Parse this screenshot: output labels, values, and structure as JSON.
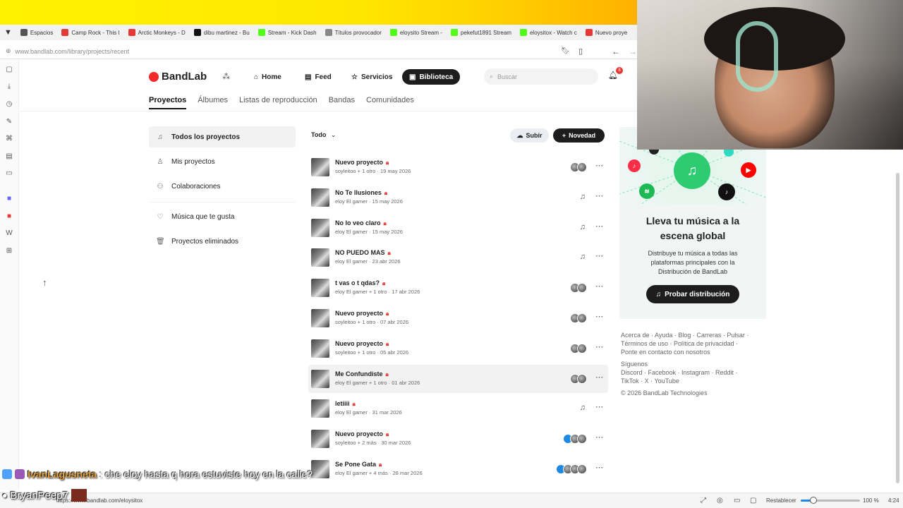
{
  "browser": {
    "tabs": [
      {
        "label": "Espacios",
        "color": "#555"
      },
      {
        "label": "Camp Rock - This I",
        "color": "#e53935"
      },
      {
        "label": "Arctic Monkeys - D",
        "color": "#e53935"
      },
      {
        "label": "dibu martinez - Bu",
        "color": "#111"
      },
      {
        "label": "Stream - Kick Dash",
        "color": "#53fc18"
      },
      {
        "label": "Títulos provocador",
        "color": "#888"
      },
      {
        "label": "eloysito Stream -",
        "color": "#53fc18"
      },
      {
        "label": "pekefut1891 Stream",
        "color": "#53fc18"
      },
      {
        "label": "eloysitox - Watch c",
        "color": "#53fc18"
      },
      {
        "label": "Nuevo proye",
        "color": "#e53935"
      }
    ],
    "url": "www.bandlab.com/library/projects/recent",
    "status_url": "https://www.bandlab.com/eloysitox",
    "status_reset": "Restablecer",
    "zoom": "100 %",
    "zoom_fraction": 0.18,
    "time": "4:24"
  },
  "header": {
    "brand": "BandLab",
    "nav": [
      {
        "label": "Home",
        "icon": "home-icon"
      },
      {
        "label": "Feed",
        "icon": "feed-icon"
      },
      {
        "label": "Servicios",
        "icon": "star-icon"
      },
      {
        "label": "Biblioteca",
        "icon": "library-icon",
        "active": true
      }
    ],
    "search_placeholder": "Buscar",
    "notifications": "8"
  },
  "subnav": [
    "Proyectos",
    "Álbumes",
    "Listas de reproducción",
    "Bandas",
    "Comunidades"
  ],
  "sidebar": [
    {
      "label": "Todos los proyectos",
      "icon": "music-note-icon",
      "selected": true
    },
    {
      "label": "Mis proyectos",
      "icon": "user-icon"
    },
    {
      "label": "Colaboraciones",
      "icon": "users-icon"
    },
    {
      "label": "Música que te gusta",
      "icon": "heart-icon"
    },
    {
      "label": "Proyectos eliminados",
      "icon": "trash-icon"
    }
  ],
  "toolbar": {
    "filter": "Todo",
    "upload": "Subir",
    "new": "Novedad"
  },
  "projects": [
    {
      "name": "Nuevo proyecto",
      "owner": "soyleitoo + 1 otro",
      "date": "19 may 2026",
      "avatars": 2,
      "collab": false
    },
    {
      "name": "No Te Ilusiones",
      "owner": "eloy El gamer",
      "date": "15 may 2026",
      "avatars": 0,
      "collab": true
    },
    {
      "name": "No lo veo claro",
      "owner": "eloy El gamer",
      "date": "15 may 2026",
      "avatars": 0,
      "collab": true
    },
    {
      "name": "NO PUEDO MAS",
      "owner": "eloy El gamer",
      "date": "23 abr 2026",
      "avatars": 0,
      "collab": true
    },
    {
      "name": "t vas o t qdas?",
      "owner": "eloy El gamer + 1 otro",
      "date": "17 abr 2026",
      "avatars": 2,
      "collab": false
    },
    {
      "name": "Nuevo proyecto",
      "owner": "soyleitoo + 1 otro",
      "date": "07 abr 2026",
      "avatars": 2,
      "collab": false
    },
    {
      "name": "Nuevo proyecto",
      "owner": "soyleitoo + 1 otro",
      "date": "05 abr 2026",
      "avatars": 2,
      "collab": false
    },
    {
      "name": "Me Confundiste",
      "owner": "eloy El gamer + 1 otro",
      "date": "01 abr 2026",
      "avatars": 2,
      "collab": false,
      "hover": true
    },
    {
      "name": "letiiii",
      "owner": "eloy El gamer",
      "date": "31 mar 2026",
      "avatars": 0,
      "collab": true
    },
    {
      "name": "Nuevo proyecto",
      "owner": "soyleitoo + 2 más",
      "date": "30 mar 2026",
      "avatars": 3,
      "collab": false
    },
    {
      "name": "Se Pone Gata",
      "owner": "eloy El gamer + 4 más",
      "date": "28 mar 2026",
      "avatars": 4,
      "collab": false
    }
  ],
  "promo": {
    "title_line1": "Lleva tu música a la",
    "title_line2": "escena global",
    "desc": "Distribuye tu música a todas las plataformas principales con la Distribución de BandLab",
    "button": "Probar distribución"
  },
  "footer": {
    "line1": "Acerca de · Ayuda · Blog · Carreras · Pulsar ·",
    "line2": "Términos de uso · Política de privacidad ·",
    "line3": "Ponte en contacto con nosotros",
    "follow": "Síguenos",
    "social1": "Discord · Facebook · Instagram · Reddit ·",
    "social2": "TikTok · X · YouTube",
    "copyright": "© 2026 BandLab Technologies"
  },
  "chat": {
    "user": "IvanLagusneta",
    "message": ": che eloy hasta q hora estuviste hoy en la calle?",
    "overlay_user": "BryanPeep7"
  },
  "colors": {
    "accent": "#f32a2a",
    "dark": "#1d1d1d",
    "lock": "#e53935",
    "kick": "#53fc18"
  }
}
